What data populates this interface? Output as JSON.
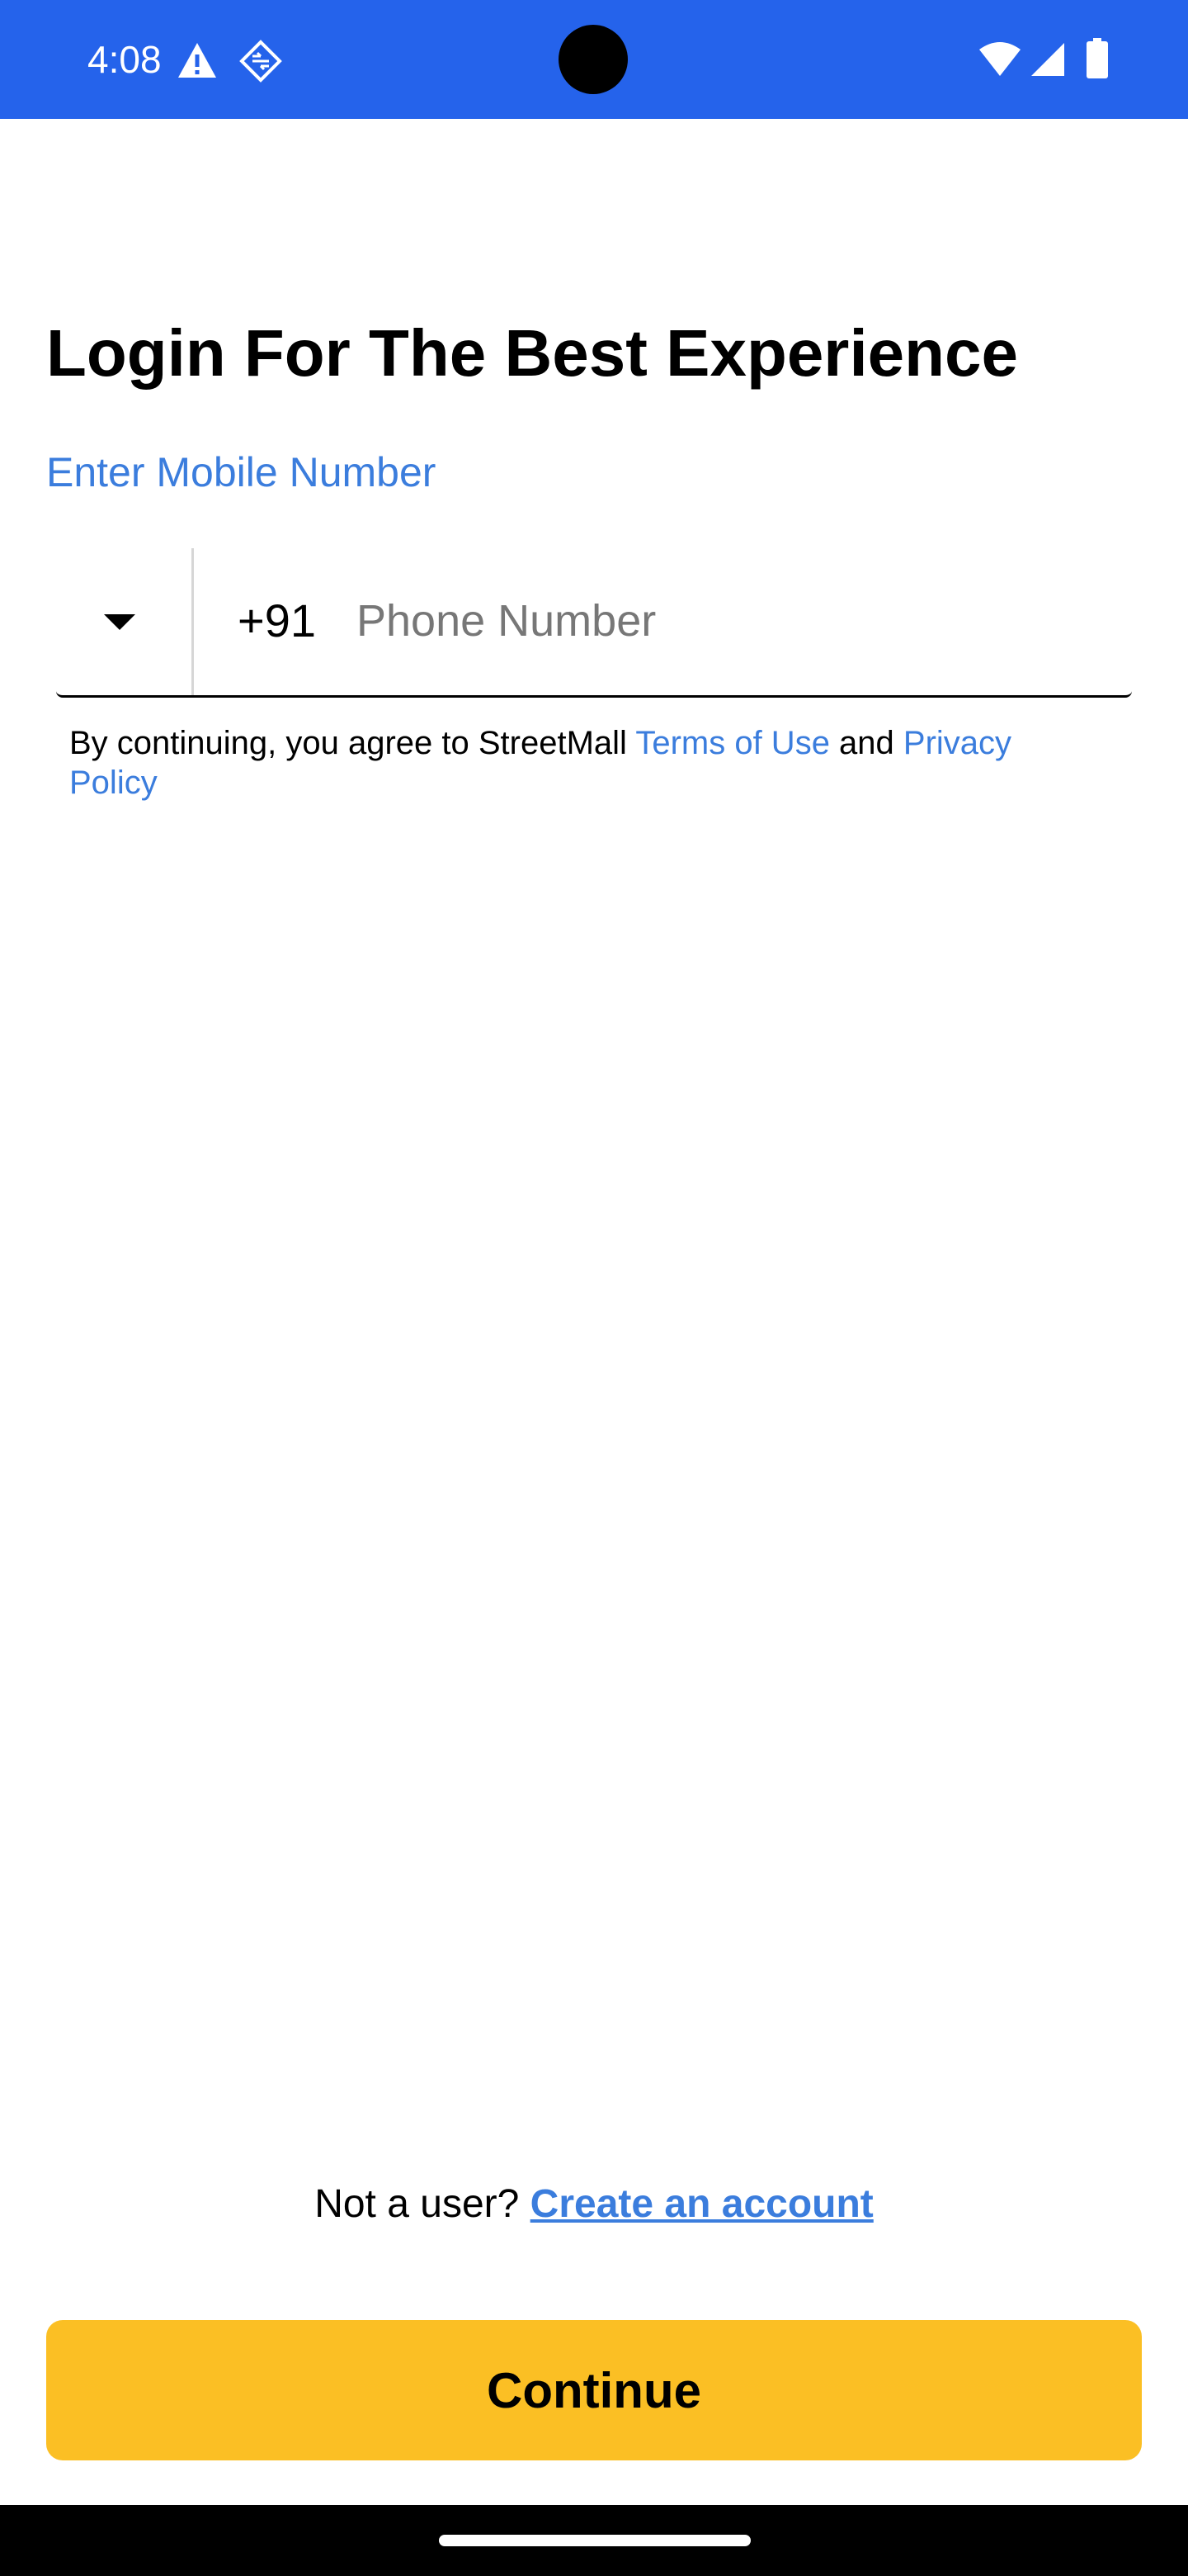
{
  "status_bar": {
    "time": "4:08",
    "background_color": "#2563eb",
    "icons": [
      "warning-icon",
      "sync-icon",
      "wifi-icon",
      "signal-icon",
      "battery-icon"
    ]
  },
  "login": {
    "title": "Login For The Best Experience",
    "mobile_label": "Enter Mobile Number",
    "country_code": "+91",
    "phone_placeholder": "Phone Number",
    "phone_value": "",
    "terms_prefix": "By continuing, you agree to StreetMall ",
    "terms_link": "Terms of Use",
    "terms_and": " and ",
    "privacy_link": "Privacy Policy"
  },
  "signup": {
    "prompt": "Not a user? ",
    "link": "Create an account"
  },
  "continue_label": "Continue",
  "colors": {
    "accent_blue": "#3b7ddd",
    "button_yellow": "#fbbf24"
  }
}
